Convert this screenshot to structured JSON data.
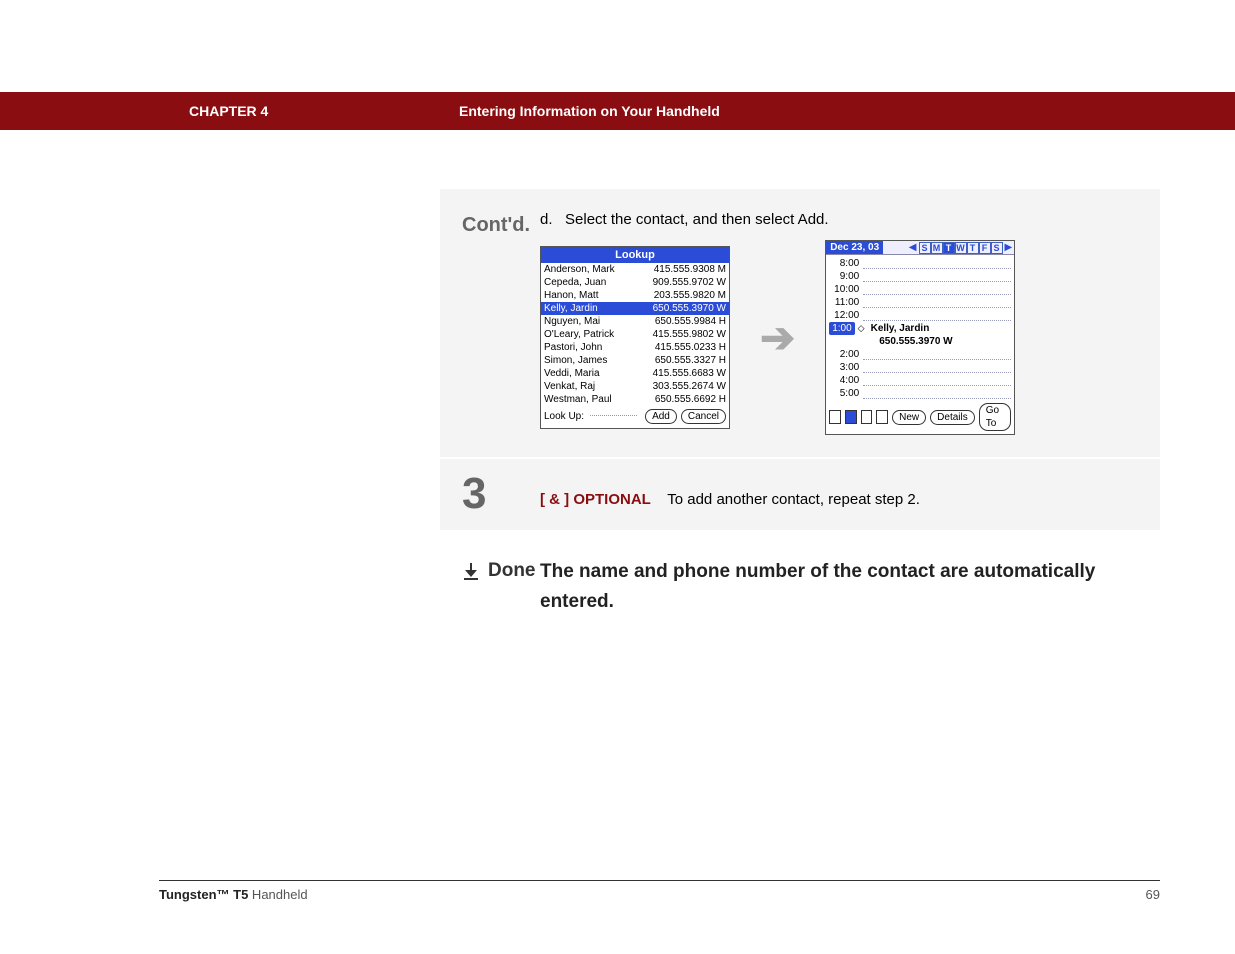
{
  "header": {
    "chapter": "CHAPTER 4",
    "section": "Entering Information on Your Handheld"
  },
  "steps": {
    "contd_label": "Cont'd.",
    "instruction_letter": "d.",
    "instruction_text": "Select the contact, and then select Add.",
    "step3_number": "3",
    "optional_tag": "[ & ]  OPTIONAL",
    "optional_text": "To add another contact, repeat step 2.",
    "done_label": "Done",
    "done_text": "The name and phone number of the contact are automatically entered."
  },
  "lookup": {
    "title": "Lookup",
    "rows": [
      {
        "name": "Anderson, Mark",
        "num": "415.555.9308 M",
        "sel": false
      },
      {
        "name": "Cepeda, Juan",
        "num": "909.555.9702 W",
        "sel": false
      },
      {
        "name": "Hanon, Matt",
        "num": "203.555.9820 M",
        "sel": false
      },
      {
        "name": "Kelly, Jardin",
        "num": "650.555.3970 W",
        "sel": true
      },
      {
        "name": "Nguyen, Mai",
        "num": "650.555.9984 H",
        "sel": false
      },
      {
        "name": "O'Leary, Patrick",
        "num": "415.555.9802 W",
        "sel": false
      },
      {
        "name": "Pastori, John",
        "num": "415.555.0233 H",
        "sel": false
      },
      {
        "name": "Simon, James",
        "num": "650.555.3327 H",
        "sel": false
      },
      {
        "name": "Veddi, Maria",
        "num": "415.555.6683 W",
        "sel": false
      },
      {
        "name": "Venkat, Raj",
        "num": "303.555.2674 W",
        "sel": false
      },
      {
        "name": "Westman, Paul",
        "num": "650.555.6692 H",
        "sel": false
      }
    ],
    "lookup_label": "Look Up:",
    "add_btn": "Add",
    "cancel_btn": "Cancel"
  },
  "calendar": {
    "date": "Dec 23, 03",
    "days": [
      "S",
      "M",
      "T",
      "W",
      "T",
      "F",
      "S"
    ],
    "selected_day_index": 2,
    "times_before": [
      "8:00",
      "9:00",
      "10:00",
      "11:00",
      "12:00"
    ],
    "event_time": "1:00",
    "event_name": "Kelly, Jardin",
    "event_phone": "650.555.3970 W",
    "times_after": [
      "2:00",
      "3:00",
      "4:00",
      "5:00"
    ],
    "new_btn": "New",
    "details_btn": "Details",
    "goto_btn": "Go To"
  },
  "footer": {
    "product_bold": "Tungsten™ T5",
    "product_rest": " Handheld",
    "page": "69"
  }
}
